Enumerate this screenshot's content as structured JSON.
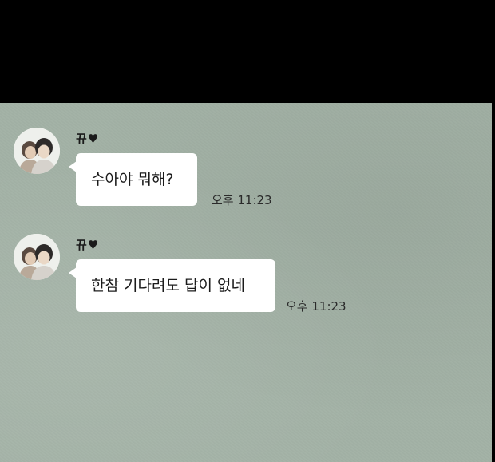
{
  "messages": [
    {
      "sender": "뀨♥",
      "text": "수아야 뭐해?",
      "time": "오후 11:23",
      "avatar_icon": "couple-avatar-icon"
    },
    {
      "sender": "뀨♥",
      "text": "한참 기다려도 답이 없네",
      "time": "오후 11:23",
      "avatar_icon": "couple-avatar-icon"
    }
  ],
  "colors": {
    "chat_background": "#a3b2a6",
    "bubble": "#ffffff",
    "top_bar": "#000000"
  }
}
